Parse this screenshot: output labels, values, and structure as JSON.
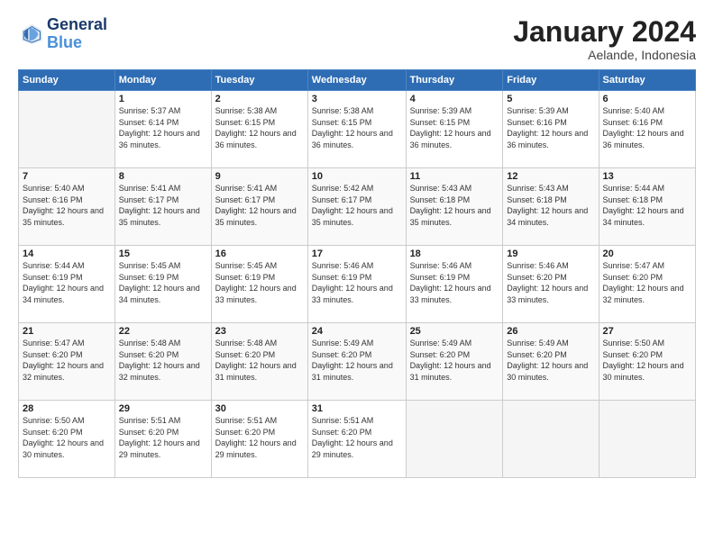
{
  "logo": {
    "line1": "General",
    "line2": "Blue"
  },
  "title": "January 2024",
  "subtitle": "Aelande, Indonesia",
  "days_of_week": [
    "Sunday",
    "Monday",
    "Tuesday",
    "Wednesday",
    "Thursday",
    "Friday",
    "Saturday"
  ],
  "weeks": [
    [
      {
        "num": "",
        "sunrise": "",
        "sunset": "",
        "daylight": ""
      },
      {
        "num": "1",
        "sunrise": "Sunrise: 5:37 AM",
        "sunset": "Sunset: 6:14 PM",
        "daylight": "Daylight: 12 hours and 36 minutes."
      },
      {
        "num": "2",
        "sunrise": "Sunrise: 5:38 AM",
        "sunset": "Sunset: 6:15 PM",
        "daylight": "Daylight: 12 hours and 36 minutes."
      },
      {
        "num": "3",
        "sunrise": "Sunrise: 5:38 AM",
        "sunset": "Sunset: 6:15 PM",
        "daylight": "Daylight: 12 hours and 36 minutes."
      },
      {
        "num": "4",
        "sunrise": "Sunrise: 5:39 AM",
        "sunset": "Sunset: 6:15 PM",
        "daylight": "Daylight: 12 hours and 36 minutes."
      },
      {
        "num": "5",
        "sunrise": "Sunrise: 5:39 AM",
        "sunset": "Sunset: 6:16 PM",
        "daylight": "Daylight: 12 hours and 36 minutes."
      },
      {
        "num": "6",
        "sunrise": "Sunrise: 5:40 AM",
        "sunset": "Sunset: 6:16 PM",
        "daylight": "Daylight: 12 hours and 36 minutes."
      }
    ],
    [
      {
        "num": "7",
        "sunrise": "Sunrise: 5:40 AM",
        "sunset": "Sunset: 6:16 PM",
        "daylight": "Daylight: 12 hours and 35 minutes."
      },
      {
        "num": "8",
        "sunrise": "Sunrise: 5:41 AM",
        "sunset": "Sunset: 6:17 PM",
        "daylight": "Daylight: 12 hours and 35 minutes."
      },
      {
        "num": "9",
        "sunrise": "Sunrise: 5:41 AM",
        "sunset": "Sunset: 6:17 PM",
        "daylight": "Daylight: 12 hours and 35 minutes."
      },
      {
        "num": "10",
        "sunrise": "Sunrise: 5:42 AM",
        "sunset": "Sunset: 6:17 PM",
        "daylight": "Daylight: 12 hours and 35 minutes."
      },
      {
        "num": "11",
        "sunrise": "Sunrise: 5:43 AM",
        "sunset": "Sunset: 6:18 PM",
        "daylight": "Daylight: 12 hours and 35 minutes."
      },
      {
        "num": "12",
        "sunrise": "Sunrise: 5:43 AM",
        "sunset": "Sunset: 6:18 PM",
        "daylight": "Daylight: 12 hours and 34 minutes."
      },
      {
        "num": "13",
        "sunrise": "Sunrise: 5:44 AM",
        "sunset": "Sunset: 6:18 PM",
        "daylight": "Daylight: 12 hours and 34 minutes."
      }
    ],
    [
      {
        "num": "14",
        "sunrise": "Sunrise: 5:44 AM",
        "sunset": "Sunset: 6:19 PM",
        "daylight": "Daylight: 12 hours and 34 minutes."
      },
      {
        "num": "15",
        "sunrise": "Sunrise: 5:45 AM",
        "sunset": "Sunset: 6:19 PM",
        "daylight": "Daylight: 12 hours and 34 minutes."
      },
      {
        "num": "16",
        "sunrise": "Sunrise: 5:45 AM",
        "sunset": "Sunset: 6:19 PM",
        "daylight": "Daylight: 12 hours and 33 minutes."
      },
      {
        "num": "17",
        "sunrise": "Sunrise: 5:46 AM",
        "sunset": "Sunset: 6:19 PM",
        "daylight": "Daylight: 12 hours and 33 minutes."
      },
      {
        "num": "18",
        "sunrise": "Sunrise: 5:46 AM",
        "sunset": "Sunset: 6:19 PM",
        "daylight": "Daylight: 12 hours and 33 minutes."
      },
      {
        "num": "19",
        "sunrise": "Sunrise: 5:46 AM",
        "sunset": "Sunset: 6:20 PM",
        "daylight": "Daylight: 12 hours and 33 minutes."
      },
      {
        "num": "20",
        "sunrise": "Sunrise: 5:47 AM",
        "sunset": "Sunset: 6:20 PM",
        "daylight": "Daylight: 12 hours and 32 minutes."
      }
    ],
    [
      {
        "num": "21",
        "sunrise": "Sunrise: 5:47 AM",
        "sunset": "Sunset: 6:20 PM",
        "daylight": "Daylight: 12 hours and 32 minutes."
      },
      {
        "num": "22",
        "sunrise": "Sunrise: 5:48 AM",
        "sunset": "Sunset: 6:20 PM",
        "daylight": "Daylight: 12 hours and 32 minutes."
      },
      {
        "num": "23",
        "sunrise": "Sunrise: 5:48 AM",
        "sunset": "Sunset: 6:20 PM",
        "daylight": "Daylight: 12 hours and 31 minutes."
      },
      {
        "num": "24",
        "sunrise": "Sunrise: 5:49 AM",
        "sunset": "Sunset: 6:20 PM",
        "daylight": "Daylight: 12 hours and 31 minutes."
      },
      {
        "num": "25",
        "sunrise": "Sunrise: 5:49 AM",
        "sunset": "Sunset: 6:20 PM",
        "daylight": "Daylight: 12 hours and 31 minutes."
      },
      {
        "num": "26",
        "sunrise": "Sunrise: 5:49 AM",
        "sunset": "Sunset: 6:20 PM",
        "daylight": "Daylight: 12 hours and 30 minutes."
      },
      {
        "num": "27",
        "sunrise": "Sunrise: 5:50 AM",
        "sunset": "Sunset: 6:20 PM",
        "daylight": "Daylight: 12 hours and 30 minutes."
      }
    ],
    [
      {
        "num": "28",
        "sunrise": "Sunrise: 5:50 AM",
        "sunset": "Sunset: 6:20 PM",
        "daylight": "Daylight: 12 hours and 30 minutes."
      },
      {
        "num": "29",
        "sunrise": "Sunrise: 5:51 AM",
        "sunset": "Sunset: 6:20 PM",
        "daylight": "Daylight: 12 hours and 29 minutes."
      },
      {
        "num": "30",
        "sunrise": "Sunrise: 5:51 AM",
        "sunset": "Sunset: 6:20 PM",
        "daylight": "Daylight: 12 hours and 29 minutes."
      },
      {
        "num": "31",
        "sunrise": "Sunrise: 5:51 AM",
        "sunset": "Sunset: 6:20 PM",
        "daylight": "Daylight: 12 hours and 29 minutes."
      },
      {
        "num": "",
        "sunrise": "",
        "sunset": "",
        "daylight": ""
      },
      {
        "num": "",
        "sunrise": "",
        "sunset": "",
        "daylight": ""
      },
      {
        "num": "",
        "sunrise": "",
        "sunset": "",
        "daylight": ""
      }
    ]
  ]
}
